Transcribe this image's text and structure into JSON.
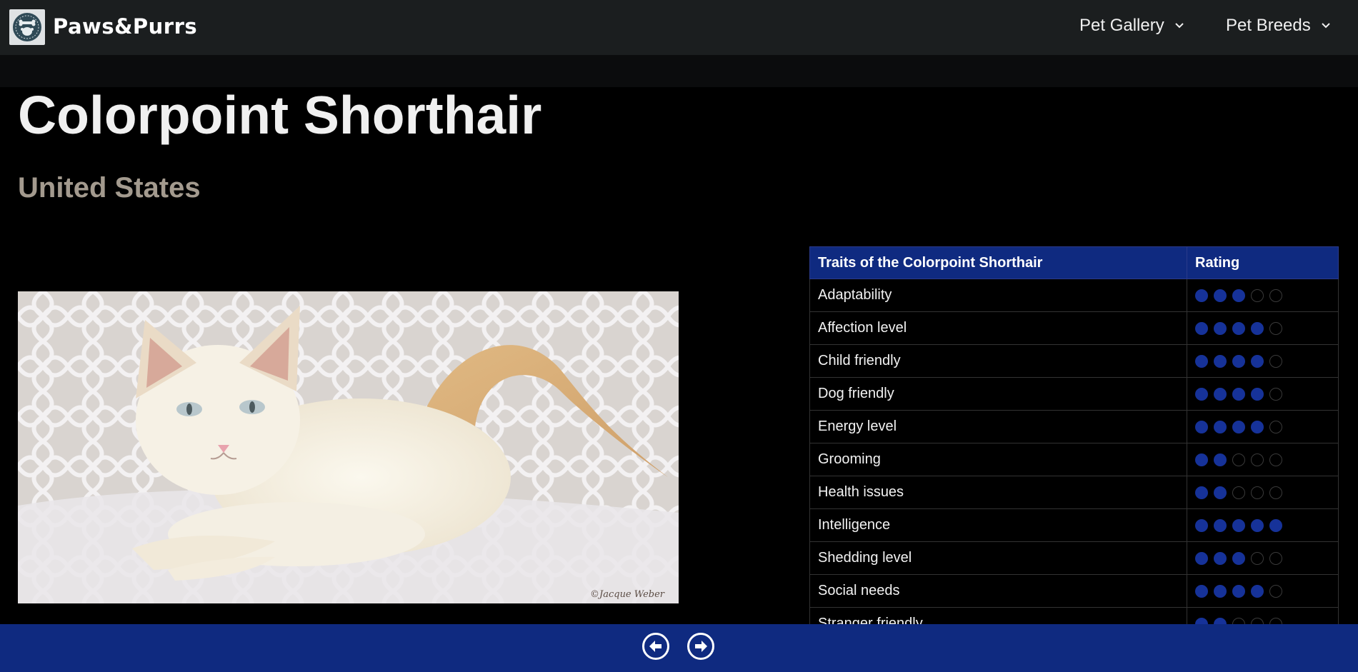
{
  "header": {
    "brand": "Paws&Purrs",
    "menus": [
      {
        "label": "Pet Gallery"
      },
      {
        "label": "Pet Breeds"
      }
    ]
  },
  "breed": {
    "title": "Colorpoint Shorthair",
    "origin": "United States",
    "photo_credit": "©Jacque Weber"
  },
  "traits_table": {
    "headers": [
      "Traits of the Colorpoint Shorthair",
      "Rating"
    ],
    "max_rating": 5,
    "rows": [
      {
        "trait": "Adaptability",
        "rating": 3
      },
      {
        "trait": "Affection level",
        "rating": 4
      },
      {
        "trait": "Child friendly",
        "rating": 4
      },
      {
        "trait": "Dog friendly",
        "rating": 4
      },
      {
        "trait": "Energy level",
        "rating": 4
      },
      {
        "trait": "Grooming",
        "rating": 2
      },
      {
        "trait": "Health issues",
        "rating": 2
      },
      {
        "trait": "Intelligence",
        "rating": 5
      },
      {
        "trait": "Shedding level",
        "rating": 3
      },
      {
        "trait": "Social needs",
        "rating": 4
      },
      {
        "trait": "Stranger friendly",
        "rating": 2
      }
    ]
  },
  "footer": {
    "buttons": [
      {
        "icon": "arrow-left-circle-icon"
      },
      {
        "icon": "arrow-right-circle-icon"
      }
    ]
  },
  "colors": {
    "accent": "#0f2a80",
    "rating_on": "#163299",
    "navbar": "#1b1e1f",
    "subtitle": "#a39a8e"
  }
}
